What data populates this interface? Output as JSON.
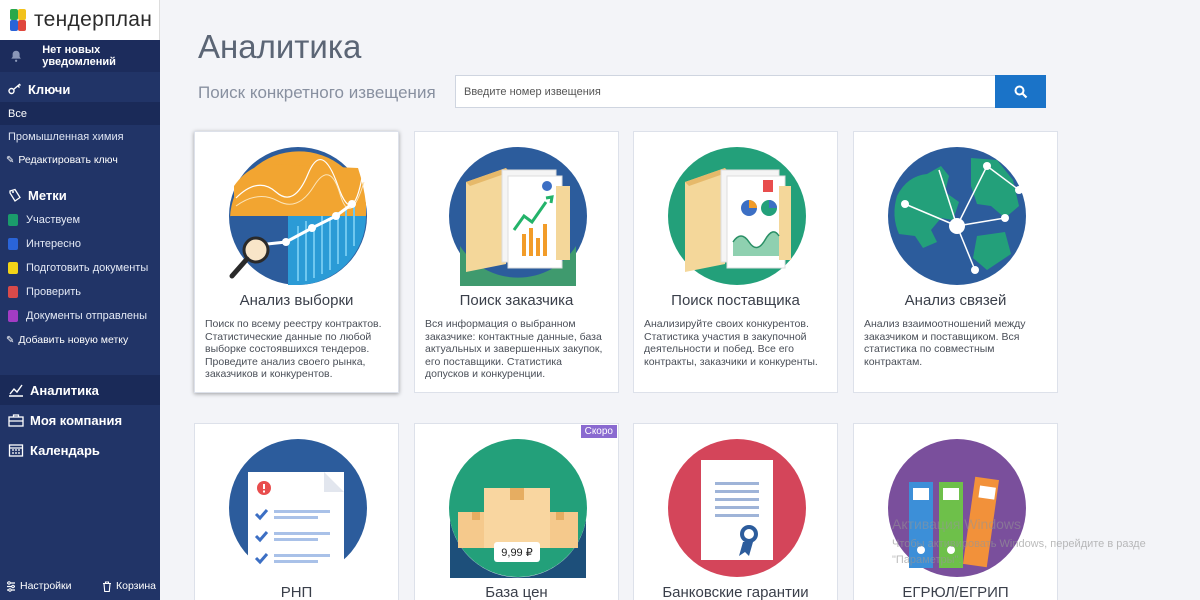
{
  "brand": {
    "name": "тендерплан"
  },
  "notifications": {
    "text": "Нет новых уведомлений"
  },
  "keys": {
    "heading": "Ключи",
    "items": [
      {
        "label": "Все",
        "active": true
      },
      {
        "label": "Промышленная химия",
        "active": false
      }
    ],
    "edit_label": "Редактировать ключ"
  },
  "tags": {
    "heading": "Метки",
    "items": [
      {
        "label": "Участвуем",
        "color": "#1a9c6b"
      },
      {
        "label": "Интересно",
        "color": "#2a64d8"
      },
      {
        "label": "Подготовить документы",
        "color": "#f2d417"
      },
      {
        "label": "Проверить",
        "color": "#d84a4a"
      },
      {
        "label": "Документы отправлены",
        "color": "#a33cc4"
      }
    ],
    "add_label": "Добавить новую метку"
  },
  "nav": {
    "analytics": "Аналитика",
    "company": "Моя компания",
    "calendar": "Календарь"
  },
  "bottom": {
    "settings": "Настройки",
    "trash": "Корзина"
  },
  "page": {
    "title": "Аналитика",
    "search_label": "Поиск конкретного извещения",
    "search_placeholder": "Введите номер извещения"
  },
  "cards": [
    {
      "title": "Анализ выборки",
      "desc": "Поиск по всему реестру контрактов. Статистические данные по любой выборке состоявшихся тендеров. Проведите анализ своего рынка, заказчиков и конкурентов."
    },
    {
      "title": "Поиск заказчика",
      "desc": "Вся информация о выбранном заказчике: контактные данные, база актуальных и завершенных закупок, его поставщики. Статистика допусков и конкуренции."
    },
    {
      "title": "Поиск поставщика",
      "desc": "Анализируйте своих конкурентов. Статистика участия в закупочной деятельности и побед. Все его контракты, заказчики и конкуренты."
    },
    {
      "title": "Анализ связей",
      "desc": "Анализ взаимоотношений между заказчиком и поставщиком. Вся статистика по совместным контрактам."
    },
    {
      "title": "РНП",
      "desc": ""
    },
    {
      "title": "База цен",
      "desc": "",
      "badge": "Скоро",
      "price": "9,99 ₽"
    },
    {
      "title": "Банковские гарантии",
      "desc": ""
    },
    {
      "title": "ЕГРЮЛ/ЕГРИП",
      "desc": ""
    }
  ],
  "watermark": {
    "line1": "Активация Windows",
    "line2": "Чтобы активировать Windows, перейдите в разде",
    "line3": "\"Параметры\"."
  },
  "colors": {
    "sidebar": "#213467",
    "accent": "#1a73c8",
    "badge": "#8a6ad0"
  }
}
